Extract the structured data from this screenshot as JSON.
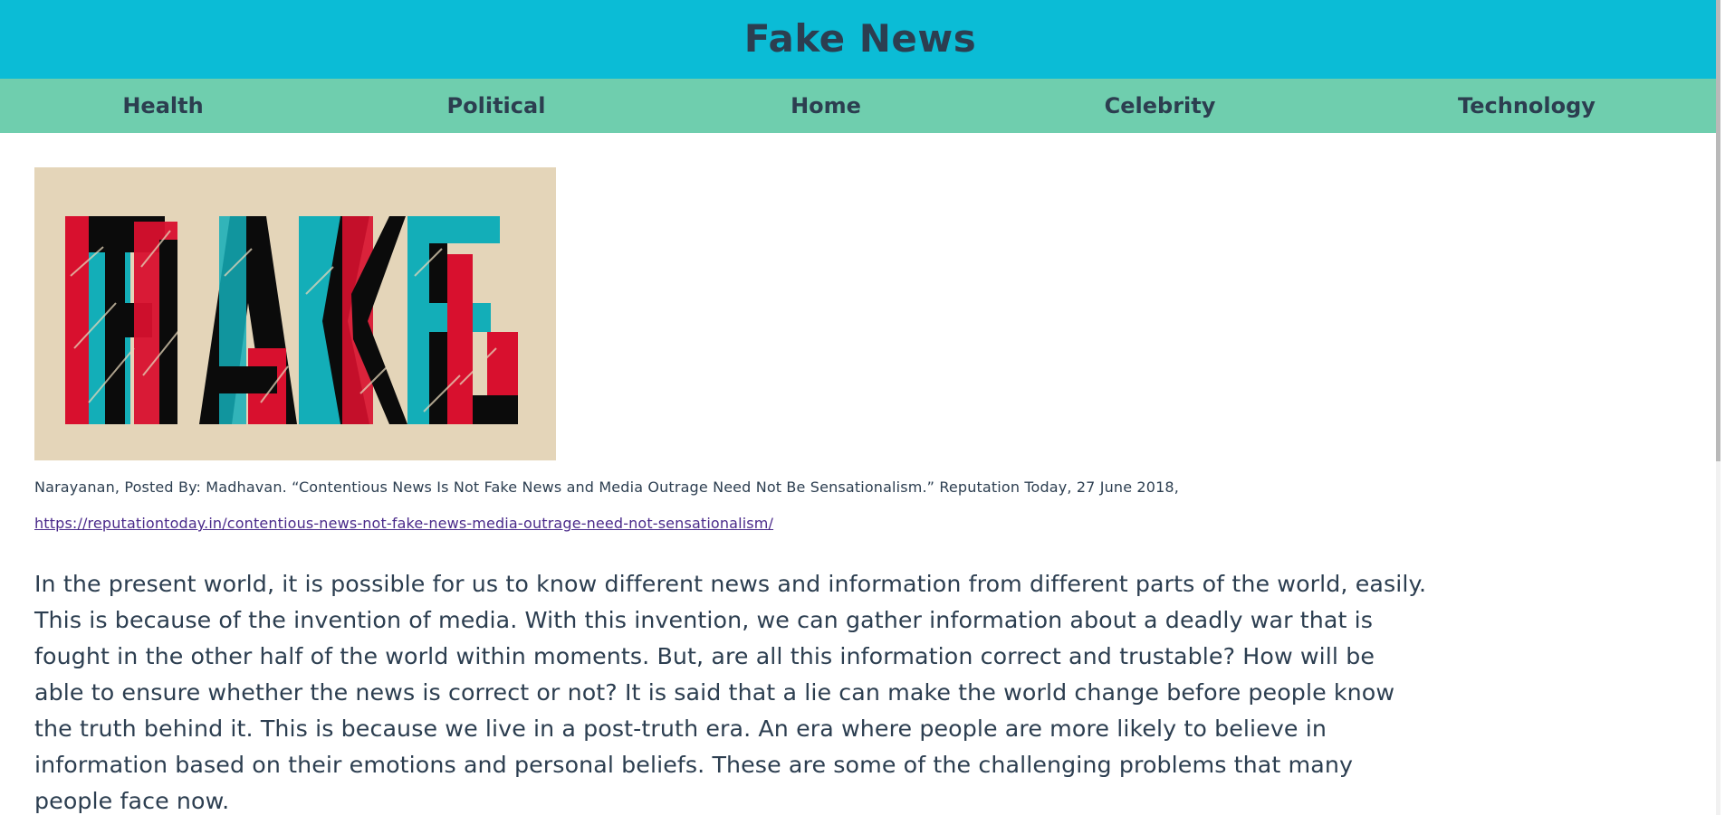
{
  "header": {
    "title": "Fake News"
  },
  "nav": {
    "items": [
      {
        "label": "Health"
      },
      {
        "label": "Political"
      },
      {
        "label": "Home"
      },
      {
        "label": "Celebrity"
      },
      {
        "label": "Technology"
      }
    ]
  },
  "hero": {
    "image_text": "FAKE",
    "colors": {
      "background": "#e4d5b9",
      "red": "#d8102e",
      "teal": "#13aeb8",
      "black": "#0b0b0b"
    }
  },
  "citation": {
    "text": "Narayanan, Posted By: Madhavan. “Contentious News Is Not Fake News and Media Outrage Need Not Be Sensationalism.” Reputation Today, 27 June 2018,",
    "link": "https://reputationtoday.in/contentious-news-not-fake-news-media-outrage-need-not-sensationalism/"
  },
  "article": {
    "paragraph": "In the present world, it is possible for us to know different news and information from different parts of the world, easily. This is because of the invention of media. With this invention, we can gather information about a deadly war that is fought in the other half of the world within moments. But, are all this information correct and trustable? How will be able to ensure whether the news is correct or not? It is said that a lie can make the world change before people know the truth behind it. This is because we live in a post-truth era. An era where people are more likely to believe in information based on their emotions and personal beliefs. These are some of the challenging problems that many people face now."
  },
  "theme": {
    "header_bg": "#0bbcd6",
    "nav_bg": "#6fceae",
    "text": "#2c3e50"
  }
}
